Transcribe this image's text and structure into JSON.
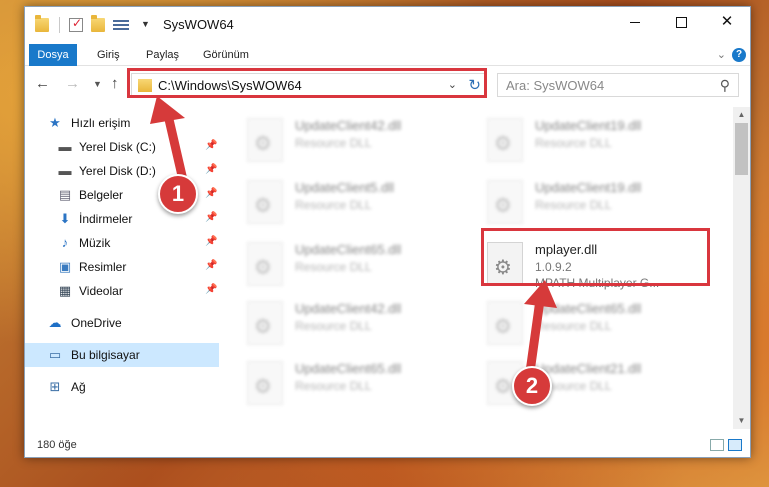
{
  "window": {
    "title": "SysWOW64"
  },
  "ribbon": {
    "tabs": [
      "Dosya",
      "Giriş",
      "Paylaş",
      "Görünüm"
    ]
  },
  "address": {
    "path": "C:\\Windows\\SysWOW64"
  },
  "search": {
    "placeholder": "Ara: SysWOW64"
  },
  "sidebar": {
    "items": [
      {
        "label": "Hızlı erişim",
        "icon": "star-icon"
      },
      {
        "label": "Yerel Disk (C:)",
        "icon": "drive-icon"
      },
      {
        "label": "Yerel Disk (D:)",
        "icon": "drive-icon"
      },
      {
        "label": "Belgeler",
        "icon": "documents-icon"
      },
      {
        "label": "İndirmeler",
        "icon": "download-icon"
      },
      {
        "label": "Müzik",
        "icon": "music-icon"
      },
      {
        "label": "Resimler",
        "icon": "pictures-icon"
      },
      {
        "label": "Videolar",
        "icon": "video-icon"
      },
      {
        "label": "OneDrive",
        "icon": "cloud-icon"
      },
      {
        "label": "Bu bilgisayar",
        "icon": "computer-icon"
      },
      {
        "label": "Ağ",
        "icon": "network-icon"
      }
    ]
  },
  "files": {
    "blurred": [
      {
        "name": "UpdateClient42.dll",
        "type": "Resource DLL"
      },
      {
        "name": "UpdateClient19.dll",
        "type": "Resource DLL"
      },
      {
        "name": "UpdateClient5.dll",
        "type": "Resource DLL"
      },
      {
        "name": "UpdateClient19.dll",
        "type": "Resource DLL"
      },
      {
        "name": "UpdateClient65.dll",
        "type": "Resource DLL"
      },
      {
        "name": "UpdateClient42.dll",
        "type": "Resource DLL"
      },
      {
        "name": "UpdateClient65.dll",
        "type": "Resource DLL"
      },
      {
        "name": "UpdateClient65.dll",
        "type": "Resource DLL"
      },
      {
        "name": "UpdateClient21.dll",
        "type": "Resource DLL"
      }
    ],
    "selected": {
      "name": "mplayer.dll",
      "version": "1.0.9.2",
      "description": "MPATH Multiplayer G..."
    }
  },
  "status": {
    "count": "180 öğe"
  },
  "annotations": {
    "badge1": "1",
    "badge2": "2",
    "color": "#d63a3a"
  }
}
